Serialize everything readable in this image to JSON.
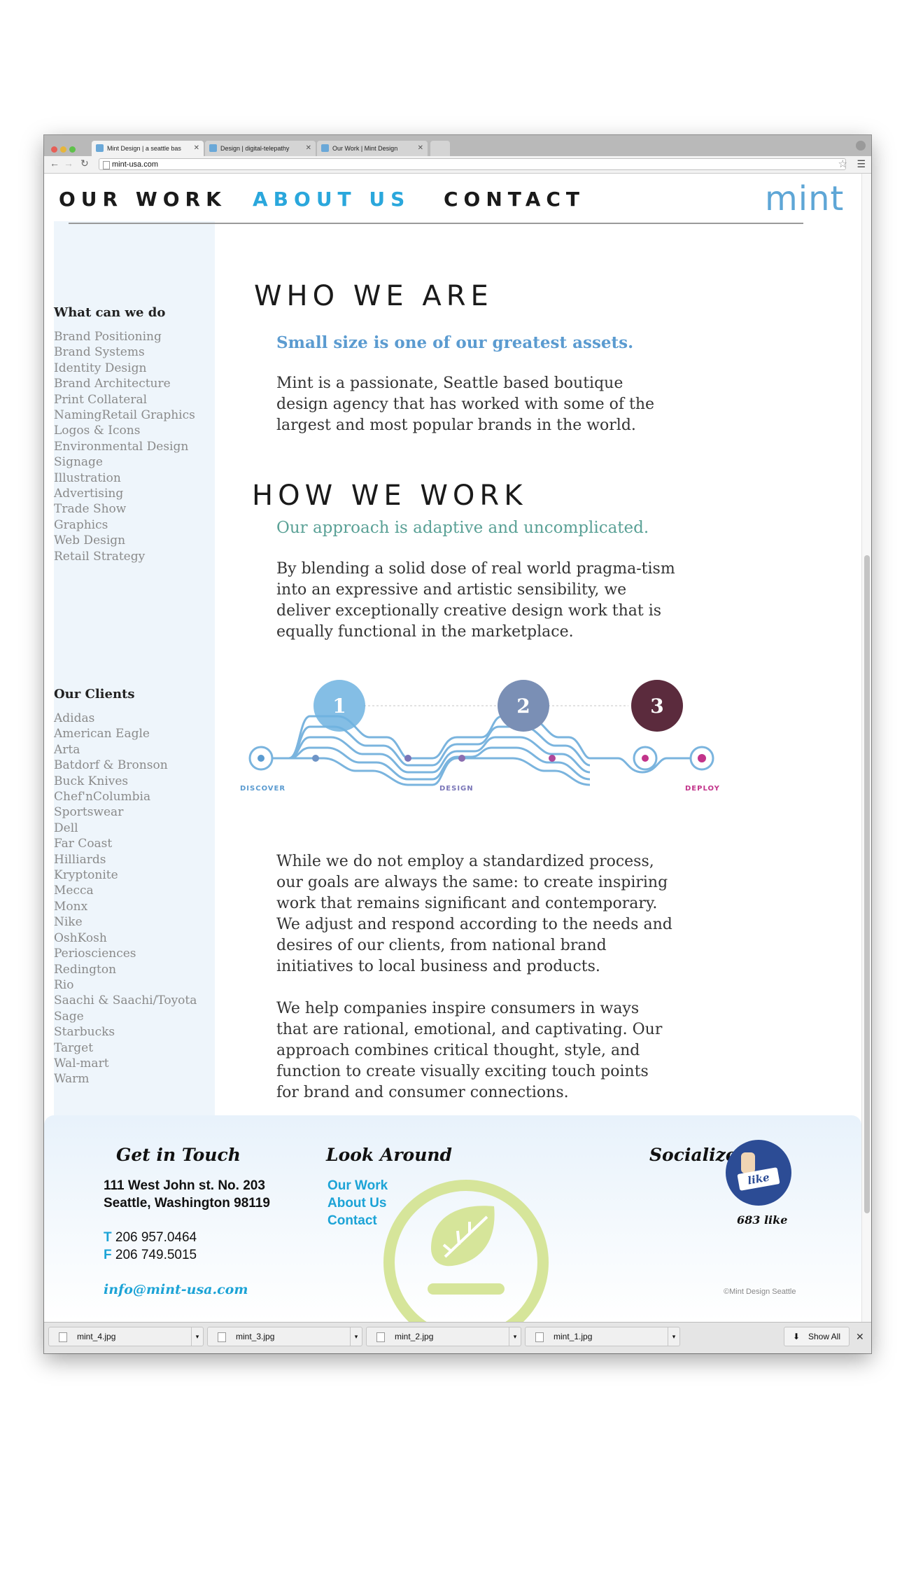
{
  "browser": {
    "tabs": [
      {
        "label": "Mint Design | a seattle bas"
      },
      {
        "label": "Design | digital-telepathy"
      },
      {
        "label": "Our Work | Mint Design"
      }
    ],
    "url": "mint-usa.com"
  },
  "nav": {
    "items": [
      "OUR WORK",
      "ABOUT US",
      "CONTACT"
    ],
    "logo": "mint"
  },
  "sidebar": {
    "services_heading": "What can we do",
    "services": [
      "Brand Positioning",
      "Brand Systems",
      "Identity Design",
      "Brand Architecture",
      "Print Collateral",
      "NamingRetail Graphics",
      "Logos & Icons",
      "Environmental Design",
      "Signage",
      "Illustration",
      "Advertising",
      "Trade Show",
      "Graphics",
      "Web Design",
      "Retail Strategy"
    ],
    "clients_heading": "Our Clients",
    "clients": [
      "Adidas",
      "American Eagle",
      "Arta",
      "Batdorf & Bronson",
      "Buck Knives",
      "Chef'nColumbia",
      "Sportswear",
      "Dell",
      "Far Coast",
      "Hilliards",
      "Kryptonite",
      "Mecca",
      "Monx",
      "Nike",
      "OshKosh",
      "Periosciences",
      "Redington",
      "Rio",
      "Saachi & Saachi/Toyota",
      "Sage",
      "Starbucks",
      "Target",
      "Wal-mart",
      "Warm"
    ]
  },
  "main": {
    "who_title": "WHO WE ARE",
    "who_lead": "Small size is one of our greatest assets.",
    "who_body": "Mint is a passionate, Seattle based boutique design agency that has worked with some of the largest and most popular brands in the world.",
    "how_title": "HOW WE WORK",
    "how_lead": "Our approach is adaptive and uncomplicated.",
    "how_body": "By blending a solid dose of real world pragma-tism into an expressive and artistic sensibility, we deliver exceptionally creative design work that is equally functional in the marketplace.",
    "process_steps": [
      "1",
      "2",
      "3"
    ],
    "process_labels": [
      "DISCOVER",
      "DESIGN",
      "DEPLOY"
    ],
    "process_body1": "While we do not employ a standardized process, our goals are always the same: to create inspiring work that remains significant and contemporary. We adjust and respond according to the needs and desires of our clients, from national brand initiatives to local business and products.",
    "process_body2": "We help companies inspire consumers in ways that are rational, emotional, and captivating. Our approach combines critical thought, style, and function to create visually exciting touch points for brand and consumer connections."
  },
  "footer": {
    "get_in_touch": "Get in Touch",
    "address1": "111 West John st. No. 203",
    "address2": "Seattle, Washington 98119",
    "phone_label": "T",
    "phone": "206 957.0464",
    "fax_label": "F",
    "fax": "206 749.5015",
    "email": "info@mint-usa.com",
    "look_around": "Look Around",
    "links": [
      "Our Work",
      "About Us",
      "Contact"
    ],
    "socialize": "Socialize",
    "like_badge": "like",
    "like_count": "683 like",
    "copyright": "©Mint Design Seattle"
  },
  "downloads": {
    "files": [
      "mint_4.jpg",
      "mint_3.jpg",
      "mint_2.jpg",
      "mint_1.jpg"
    ],
    "show_all": "Show All"
  },
  "colors": {
    "accent_blue": "#2aa7dc",
    "lead_blue": "#5b9bd0",
    "lead_teal": "#5aa196",
    "sidebar_bg": "#eef5fb",
    "watermark_green": "#d6e59a",
    "deploy_pink": "#c2338a"
  }
}
